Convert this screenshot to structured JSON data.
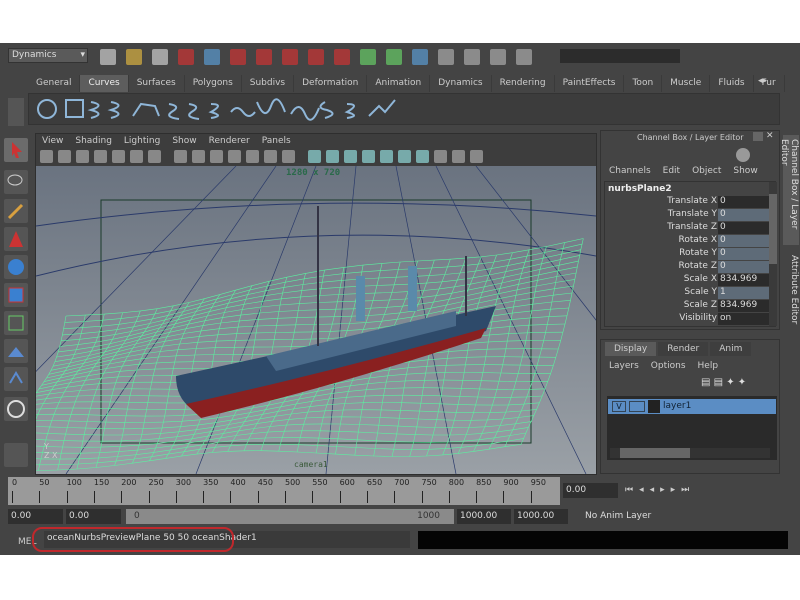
{
  "menu_set": "Dynamics",
  "shelf_tabs": [
    "General",
    "Curves",
    "Surfaces",
    "Polygons",
    "Subdivs",
    "Deformation",
    "Animation",
    "Dynamics",
    "Rendering",
    "PaintEffects",
    "Toon",
    "Muscle",
    "Fluids",
    "Fur"
  ],
  "active_shelf_tab": "Curves",
  "viewport": {
    "menu": [
      "View",
      "Shading",
      "Lighting",
      "Show",
      "Renderer",
      "Panels"
    ],
    "resolution": "1280 x 720",
    "camera": "camera1"
  },
  "channel_box": {
    "title": "Channel Box / Layer Editor",
    "menu": [
      "Channels",
      "Edit",
      "Object",
      "Show"
    ],
    "object": "nurbsPlane2",
    "attrs": [
      {
        "label": "Translate X",
        "value": "0"
      },
      {
        "label": "Translate Y",
        "value": "0"
      },
      {
        "label": "Translate Z",
        "value": "0"
      },
      {
        "label": "Rotate X",
        "value": "0"
      },
      {
        "label": "Rotate Y",
        "value": "0"
      },
      {
        "label": "Rotate Z",
        "value": "0"
      },
      {
        "label": "Scale X",
        "value": "834.969"
      },
      {
        "label": "Scale Y",
        "value": "1"
      },
      {
        "label": "Scale Z",
        "value": "834.969"
      },
      {
        "label": "Visibility",
        "value": "on"
      }
    ]
  },
  "side_tabs": [
    "Channel Box / Layer Editor",
    "Attribute Editor"
  ],
  "layer_editor": {
    "tabs": [
      "Display",
      "Render",
      "Anim"
    ],
    "menu": [
      "Layers",
      "Options",
      "Help"
    ],
    "layer": {
      "visible": "V",
      "name": "layer1"
    }
  },
  "timeline": {
    "ticks": [
      "0",
      "50",
      "100",
      "150",
      "200",
      "250",
      "300",
      "350",
      "400",
      "450",
      "500",
      "550",
      "600",
      "650",
      "700",
      "750",
      "800",
      "850",
      "900",
      "950"
    ],
    "current_frame": "0.00",
    "start": "0.00",
    "start2": "0.00",
    "range_start": "0",
    "range_end": "1000",
    "end": "1000.00",
    "end2": "1000.00",
    "anim_layer": "No Anim Layer"
  },
  "command_line": {
    "label": "MEL",
    "value": "oceanNurbsPreviewPlane 50 50 oceanShader1"
  },
  "colors": {
    "accent": "#5b8dc4",
    "highlight": "#c0282c",
    "grid": "#5cf0a0"
  }
}
